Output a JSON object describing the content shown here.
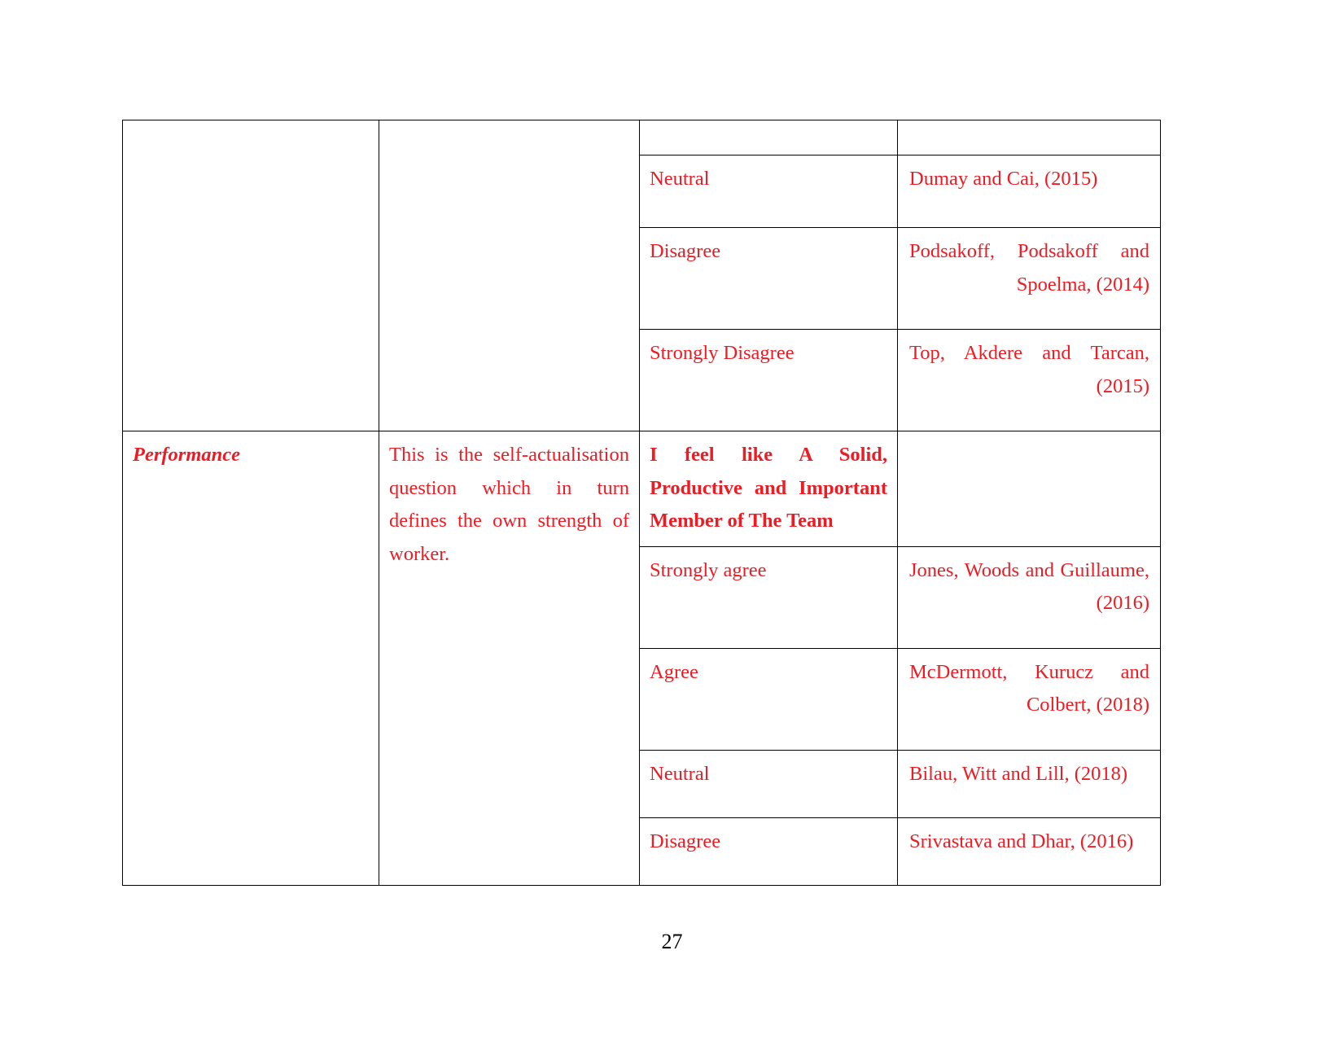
{
  "page": {
    "number": "27",
    "text_color": "#ED1C24",
    "border_color": "#000000",
    "background": "#FFFFFF"
  },
  "table": {
    "column_count": 4,
    "rows": [
      {
        "id": "row-top-empty",
        "construct": "",
        "description": "",
        "scale_item": "",
        "reference": ""
      },
      {
        "id": "row-neutral-1",
        "construct": "",
        "description": "",
        "scale_item": "Neutral",
        "reference": "Dumay and Cai, (2015)"
      },
      {
        "id": "row-disagree-1",
        "construct": "",
        "description": "",
        "scale_item": "Disagree",
        "reference": "Podsakoff, Podsakoff and Spoelma, (2014)"
      },
      {
        "id": "row-strongly-disagree-1",
        "construct": "",
        "description": "",
        "scale_item": "Strongly Disagree",
        "reference": "Top, Akdere and Tarcan, (2015)"
      },
      {
        "id": "row-performance",
        "construct": "Performance",
        "description": "This is the self-actualisation question which in turn defines the own strength of worker.",
        "scale_item": "I feel like A Solid, Productive and Important Member of The Team",
        "scale_item_bold": true,
        "reference": ""
      },
      {
        "id": "row-strongly-agree-2",
        "construct": "",
        "description": "",
        "scale_item": "Strongly agree",
        "reference": "Jones, Woods and Guillaume, (2016)"
      },
      {
        "id": "row-agree-2",
        "construct": "",
        "description": "",
        "scale_item": "Agree",
        "reference": "McDermott, Kurucz and Colbert, (2018)"
      },
      {
        "id": "row-neutral-2",
        "construct": "",
        "description": "",
        "scale_item": "Neutral",
        "reference": "Bilau, Witt and Lill, (2018)"
      },
      {
        "id": "row-disagree-2",
        "construct": "",
        "description": "",
        "scale_item": "Disagree",
        "reference": "Srivastava and Dhar, (2016)"
      }
    ]
  }
}
